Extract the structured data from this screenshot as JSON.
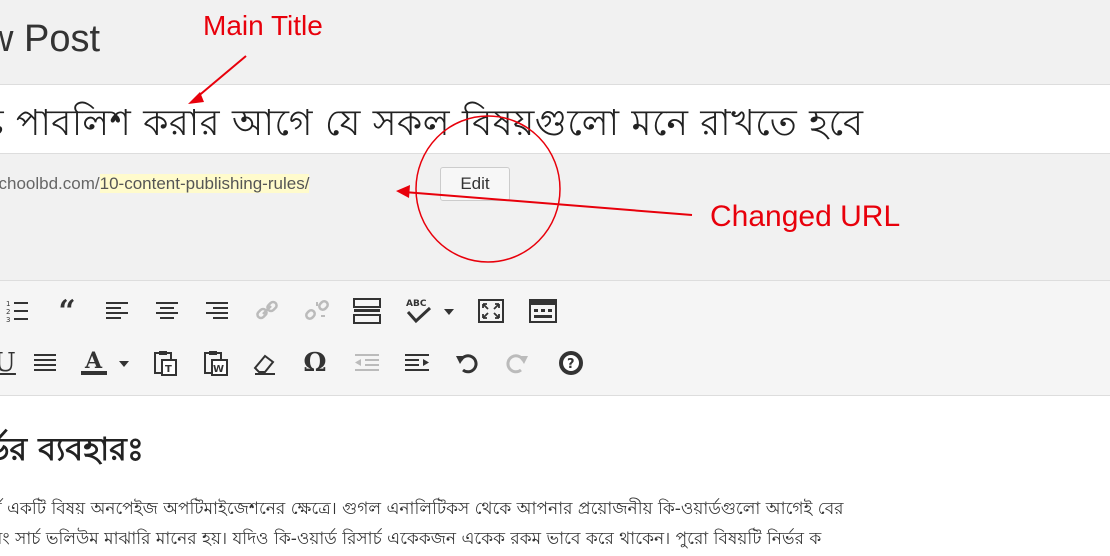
{
  "header": {
    "page_title": "w Post"
  },
  "annotations": {
    "main_title": "Main Title",
    "changed_url": "Changed URL",
    "color": "#e8000b"
  },
  "post": {
    "title": "ষ্ট পাবলিশ করার আগে যে সকল বিষয়গুলো মনে রাখতে হবে",
    "permalink_prefix": "schoolbd.com/",
    "permalink_slug": "10-content-publishing-rules/",
    "edit_label": "Edit"
  },
  "toolbar": {
    "row1": [
      "ordered-list",
      "blockquote",
      "align-left",
      "align-center",
      "align-right",
      "insert-link",
      "remove-link",
      "read-more",
      "spellcheck",
      "fullscreen",
      "toolbar-toggle"
    ],
    "row2": [
      "underline",
      "justify",
      "text-color",
      "paste-text",
      "paste-word",
      "clear-formatting",
      "special-character",
      "outdent",
      "indent",
      "undo",
      "redo",
      "help"
    ]
  },
  "content": {
    "heading": "র্ডর ব্যবহারঃ",
    "line1": "পুর্ন একটি বিষয় অনপেইজ অপটিমাইজেশনের ক্ষেত্রে। গুগল এনালিটিকস থেকে আপনার প্রয়োজনীয় কি-ওয়ার্ডগুলো আগেই বের",
    "line2": "এবং সার্চ ভলিউম মাঝারি মানের হয়। যদিও কি-ওয়ার্ড রিসার্চ একেকজন একেক রকম ভাবে করে থাকেন। পুরো বিষয়টি নির্ভর ক"
  }
}
